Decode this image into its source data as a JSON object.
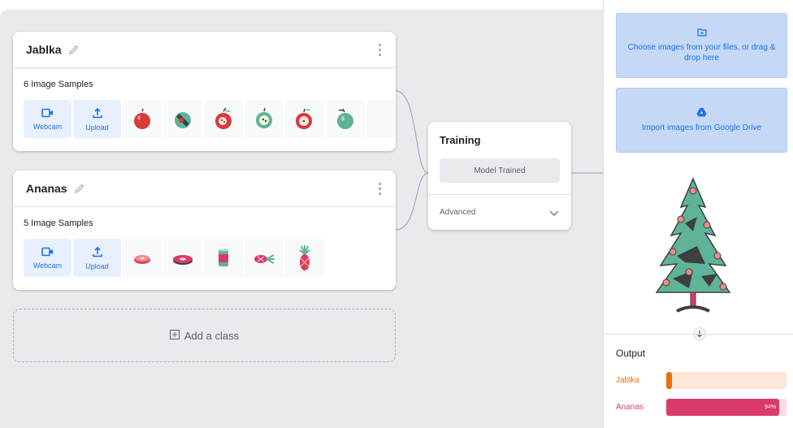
{
  "classes": [
    {
      "name": "Jablka",
      "samples_label": "6 Image Samples",
      "webcam_label": "Webcam",
      "upload_label": "Upload",
      "samples": [
        "apple-red-icon",
        "apple-green-slice-icon",
        "apple-red-half-icon",
        "apple-green-half-icon",
        "apple-bitten-icon",
        "apple-green-icon"
      ]
    },
    {
      "name": "Ananas",
      "samples_label": "5 Image Samples",
      "webcam_label": "Webcam",
      "upload_label": "Upload",
      "samples": [
        "pineapple-slice-icon",
        "pineapple-ring-icon",
        "pineapple-can-icon",
        "pineapple-lying-icon",
        "pineapple-whole-icon"
      ]
    }
  ],
  "add_class_label": "Add a class",
  "training": {
    "title": "Training",
    "button_label": "Model Trained",
    "advanced_label": "Advanced"
  },
  "preview": {
    "choose_files_label": "Choose images from your files, or drag & drop here",
    "drive_label": "Import images from Google Drive",
    "image_icon": "christmas-tree-icon"
  },
  "output": {
    "title": "Output",
    "rows": [
      {
        "label": "Jablka",
        "value_label": "",
        "fraction": 0.05,
        "color": "#e8710a",
        "track_color": "#fde5d8"
      },
      {
        "label": "Ananas",
        "value_label": "94%",
        "fraction": 0.94,
        "color": "#d93a6a",
        "track_color": "#fbdbe4"
      }
    ]
  },
  "colors": {
    "accent": "#1a73e8",
    "workspace_bg": "#e8eaed"
  }
}
